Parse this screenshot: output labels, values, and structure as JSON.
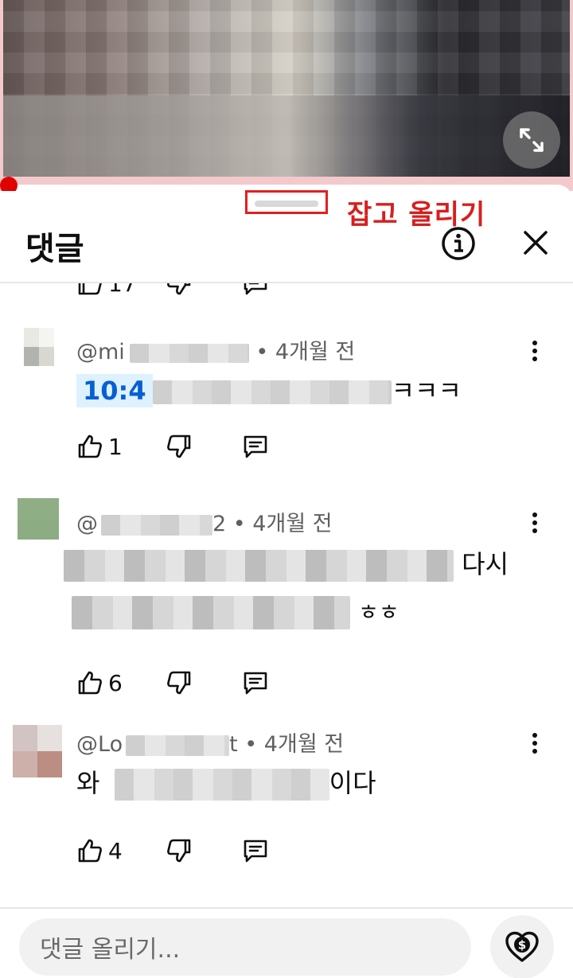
{
  "annotation": {
    "label": "잡고 올리기"
  },
  "header": {
    "title": "댓글"
  },
  "comments": [
    {
      "author": "@mi",
      "age": "4개월 전",
      "timestamp_link": "10:4",
      "text_suffix": "ㅋㅋㅋ",
      "likes": "1",
      "avatar_colors": [
        "#e9e8e2",
        "#f4f4f2",
        "#b1b4ae",
        "#d9d8d0"
      ]
    },
    {
      "author": "@",
      "author_suffix": "2",
      "age": "4개월 전",
      "line1_suffix": "다시",
      "line2_suffix": "ㅎㅎ",
      "likes": "6",
      "avatar_colors": [
        "#8fae86",
        "#8fae86",
        "#8cac83",
        "#8cac83"
      ]
    },
    {
      "author": "@Lo",
      "author_suffix": "t",
      "age": "4개월 전",
      "text_prefix": "와",
      "text_suffix": "이다",
      "likes": "4",
      "avatar_colors": [
        "#d2c4c2",
        "#e6e1de",
        "#cdb0a9",
        "#bb8d83"
      ]
    }
  ],
  "previous_comment": {
    "likes": "17"
  },
  "composer": {
    "placeholder": "댓글 올리기..."
  },
  "icons": {
    "expand": "expand-icon",
    "info": "info-icon",
    "close": "close-icon",
    "like": "thumb-up-icon",
    "dislike": "thumb-down-icon",
    "reply": "reply-icon",
    "more": "more-vert-icon",
    "donate": "heart-dollar-icon"
  },
  "colors": {
    "accent_red": "#d81e1e",
    "link_blue": "#065fd4",
    "progress_red": "#e00000"
  }
}
